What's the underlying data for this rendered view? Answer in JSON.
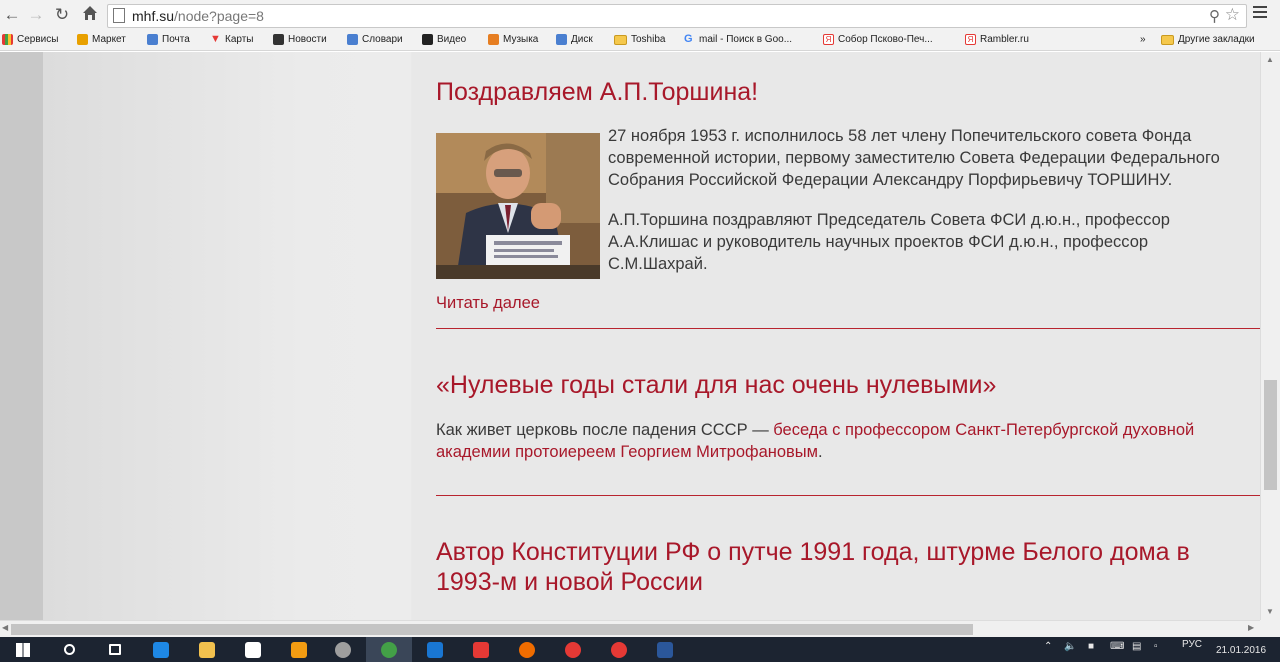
{
  "browser": {
    "url_host": "mhf.su",
    "url_path": "/node?page=8"
  },
  "bookmarks": [
    {
      "label": "Сервисы",
      "icon": "apps-grid-icon",
      "color": "#4285f4"
    },
    {
      "label": "Маркет",
      "icon": "yandex-market-icon",
      "color": "#e8a000"
    },
    {
      "label": "Почта",
      "icon": "mail-icon",
      "color": "#4a7fd0"
    },
    {
      "label": "Карты",
      "icon": "map-pin-icon",
      "color": "#e53935"
    },
    {
      "label": "Новости",
      "icon": "news-icon",
      "color": "#333333"
    },
    {
      "label": "Словари",
      "icon": "dictionary-icon",
      "color": "#4a7fd0"
    },
    {
      "label": "Видео",
      "icon": "video-play-icon",
      "color": "#222222"
    },
    {
      "label": "Музыка",
      "icon": "music-icon",
      "color": "#e67e22"
    },
    {
      "label": "Диск",
      "icon": "disk-icon",
      "color": "#4a7fd0"
    },
    {
      "label": "Toshiba",
      "icon": "folder-icon",
      "color": "#f5c84c"
    },
    {
      "label": "mail - Поиск в Goo...",
      "icon": "google-icon",
      "color": "#4285f4"
    },
    {
      "label": "Собор Псково-Печ...",
      "icon": "yandex-icon",
      "color": "#e53935"
    },
    {
      "label": "Rambler.ru",
      "icon": "yandex-icon",
      "color": "#e53935"
    }
  ],
  "bookmarks_more": "»",
  "bookmarks_other": "Другие закладки",
  "articles": [
    {
      "title": "Поздравляем А.П.Торшина!",
      "paragraphs": [
        "27 ноября 1953 г. исполнилось 58 лет члену Попечительского совета Фонда современной истории, первому заместителю Совета Федерации Федерального Собрания Российской Федерации Александру Порфирьевичу ТОРШИНУ.",
        "А.П.Торшина поздравляют Председатель Совета ФСИ д.ю.н., профессор А.А.Клишас и руководитель научных проектов ФСИ д.ю.н., профессор С.М.Шахрай."
      ],
      "read_more": "Читать далее"
    },
    {
      "title": "«Нулевые годы стали для нас очень нулевыми»",
      "text_plain": "Как живет церковь после падения СССР — ",
      "text_link": "беседа с профессором Санкт-Петербургской духовной академии протоиереем Георгием Митрофановым",
      "text_end": "."
    },
    {
      "title": "Автор Конституции РФ о путче 1991 года, штурме Белого дома в 1993-м и новой России"
    }
  ],
  "taskbar": {
    "lang": "РУС",
    "date": "21.01.2016",
    "apps": [
      {
        "icon": "windows-start-icon",
        "color": "#ffffff"
      },
      {
        "icon": "search-icon",
        "color": "#ffffff"
      },
      {
        "icon": "task-view-icon",
        "color": "#ffffff"
      },
      {
        "icon": "edge-icon",
        "color": "#1e88e5"
      },
      {
        "icon": "file-explorer-icon",
        "color": "#f2c14e"
      },
      {
        "icon": "store-icon",
        "color": "#ffffff"
      },
      {
        "icon": "media-player-icon",
        "color": "#f39c12"
      },
      {
        "icon": "cd-icon",
        "color": "#9e9e9e"
      },
      {
        "icon": "chrome-icon",
        "color": "#43a047"
      },
      {
        "icon": "mail-app-icon",
        "color": "#1976d2"
      },
      {
        "icon": "yandex-app-icon",
        "color": "#e53935"
      },
      {
        "icon": "firefox-icon",
        "color": "#ef6c00"
      },
      {
        "icon": "opera-icon",
        "color": "#e53935"
      },
      {
        "icon": "yandex-browser-icon",
        "color": "#e53935"
      },
      {
        "icon": "word-icon",
        "color": "#2b579a"
      }
    ]
  }
}
